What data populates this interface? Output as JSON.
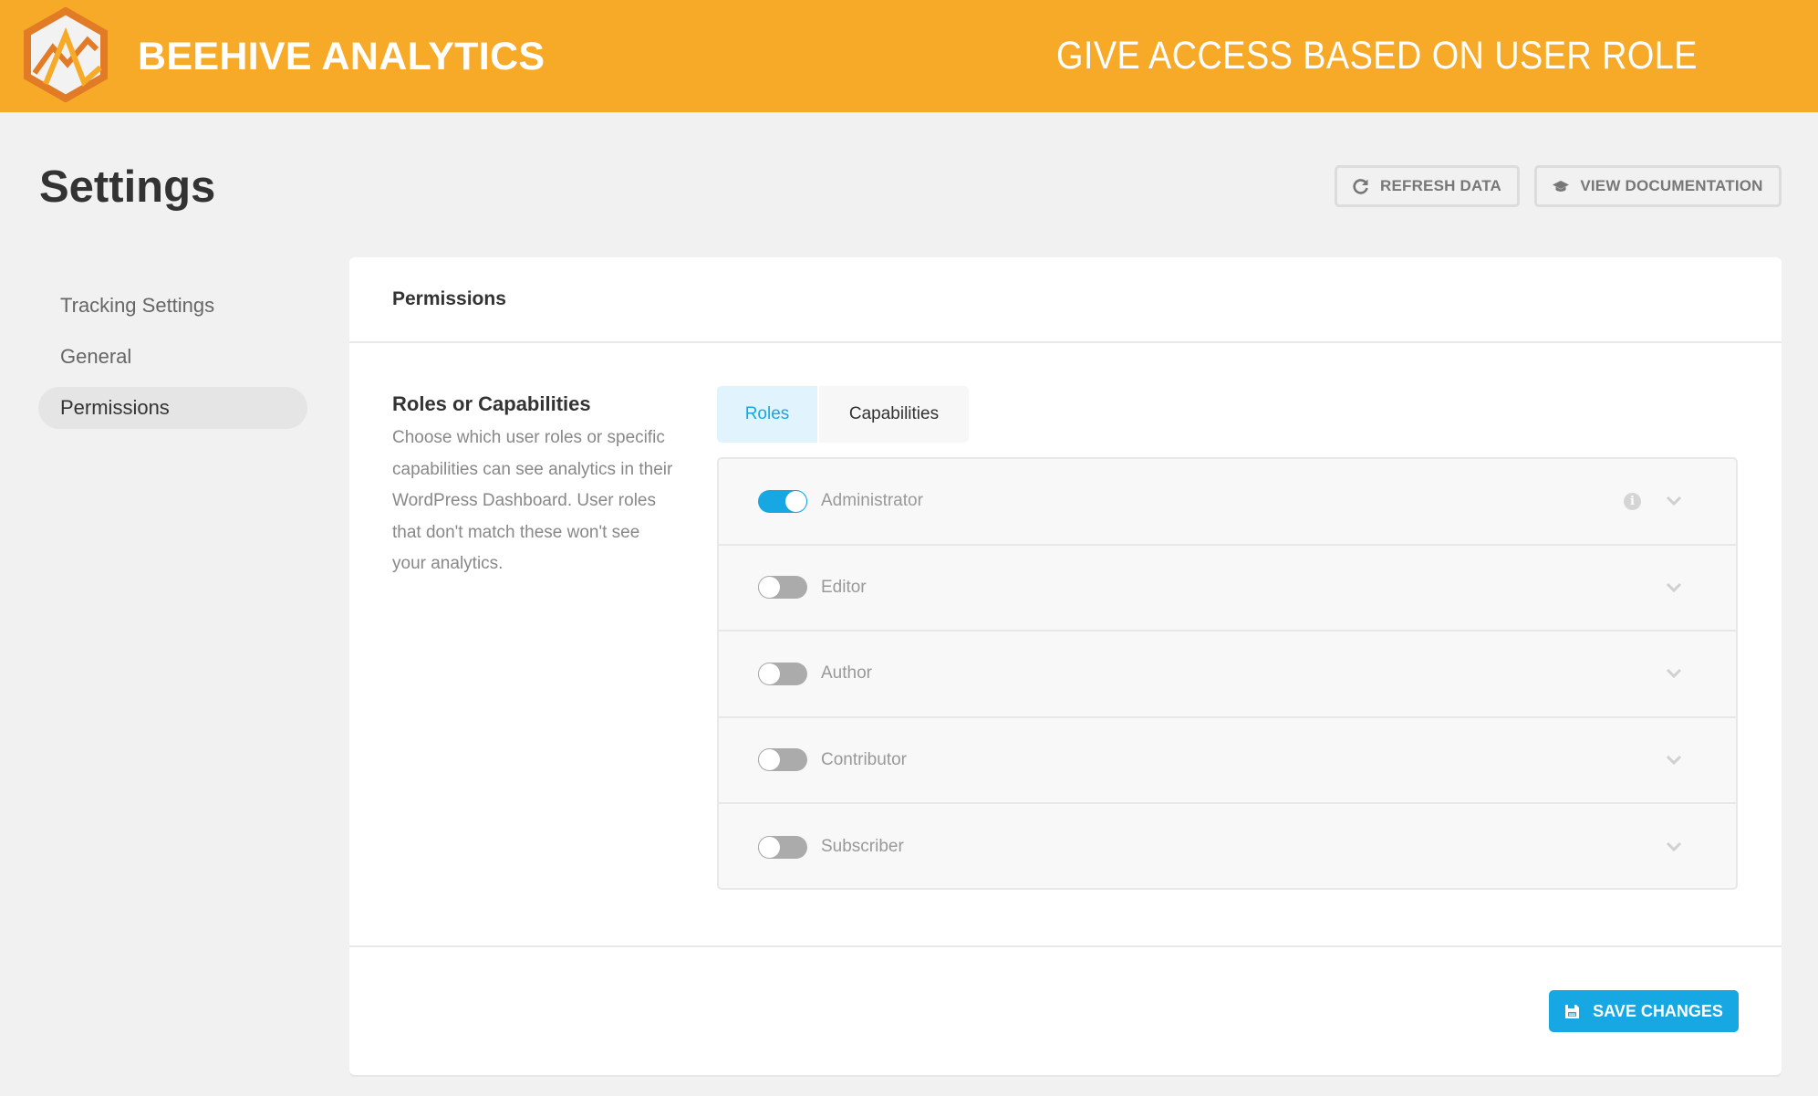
{
  "header": {
    "brand": "BEEHIVE ANALYTICS",
    "tagline": "GIVE ACCESS BASED ON USER ROLE",
    "brand_color": "#f7aa28",
    "logo_icon": "beehive-hexagon-logo"
  },
  "page": {
    "title": "Settings"
  },
  "toolbar": {
    "refresh_label": "REFRESH DATA",
    "refresh_icon": "refresh-icon",
    "docs_label": "VIEW DOCUMENTATION",
    "docs_icon": "graduation-cap-icon"
  },
  "sidebar": {
    "items": [
      {
        "label": "Tracking Settings",
        "active": false
      },
      {
        "label": "General",
        "active": false
      },
      {
        "label": "Permissions",
        "active": true
      }
    ]
  },
  "card": {
    "title": "Permissions",
    "section": {
      "title": "Roles or Capabilities",
      "description": "Choose which user roles or specific capabilities can see analytics in their WordPress Dashboard. User roles that don't match these won't see your analytics."
    },
    "tabs": [
      {
        "label": "Roles",
        "active": true
      },
      {
        "label": "Capabilities",
        "active": false
      }
    ],
    "roles": [
      {
        "label": "Administrator",
        "enabled": true,
        "has_info": true
      },
      {
        "label": "Editor",
        "enabled": false,
        "has_info": false
      },
      {
        "label": "Author",
        "enabled": false,
        "has_info": false
      },
      {
        "label": "Contributor",
        "enabled": false,
        "has_info": false
      },
      {
        "label": "Subscriber",
        "enabled": false,
        "has_info": false
      }
    ],
    "save_label": "SAVE CHANGES",
    "save_icon": "floppy-disk-icon",
    "accent_color": "#17a8e3"
  }
}
